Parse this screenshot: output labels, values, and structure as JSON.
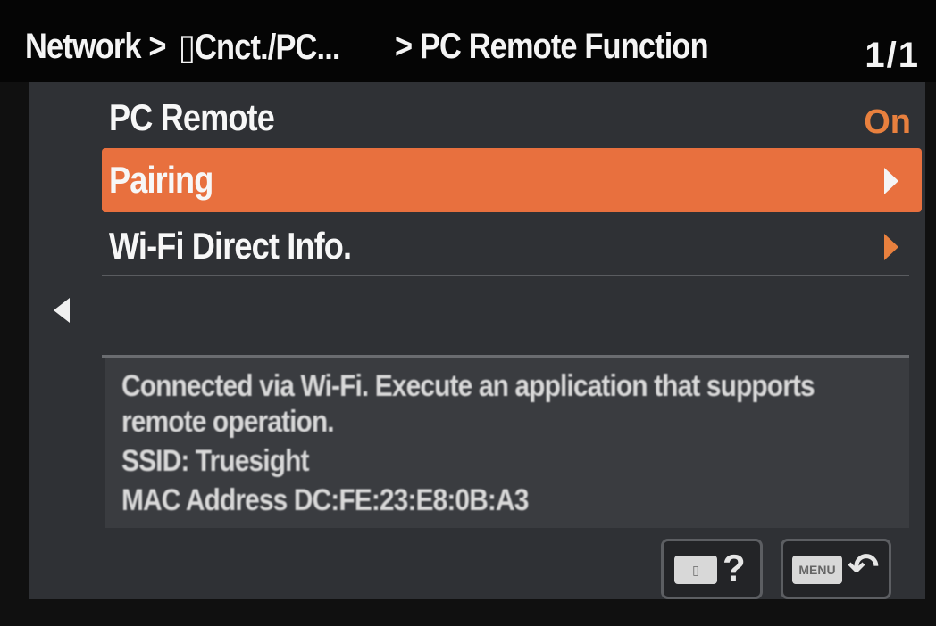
{
  "header": {
    "crumb_network": "Network >",
    "crumb_connect": "▯Cnct./PC...",
    "crumb_current": "> PC Remote Function",
    "page_indicator": "1/1"
  },
  "menu": {
    "items": [
      {
        "label": "PC Remote",
        "value": "On"
      },
      {
        "label": "Pairing"
      },
      {
        "label": "Wi-Fi Direct Info."
      }
    ],
    "selected_index": 1,
    "accent_color": "#e8703e"
  },
  "info": {
    "line1": "Connected via Wi-Fi. Execute an application that supports",
    "line2": "remote operation.",
    "line3": "SSID: Truesight",
    "line4": "MAC Address  DC:FE:23:E8:0B:A3"
  },
  "footer": {
    "help_key": "▯",
    "help_glyph": "?",
    "back_key": "MENU",
    "back_glyph": "↶"
  },
  "icons": {
    "left": "left-arrow-icon",
    "chevron": "chevron-right-icon",
    "help": "help-icon",
    "back": "back-icon"
  }
}
